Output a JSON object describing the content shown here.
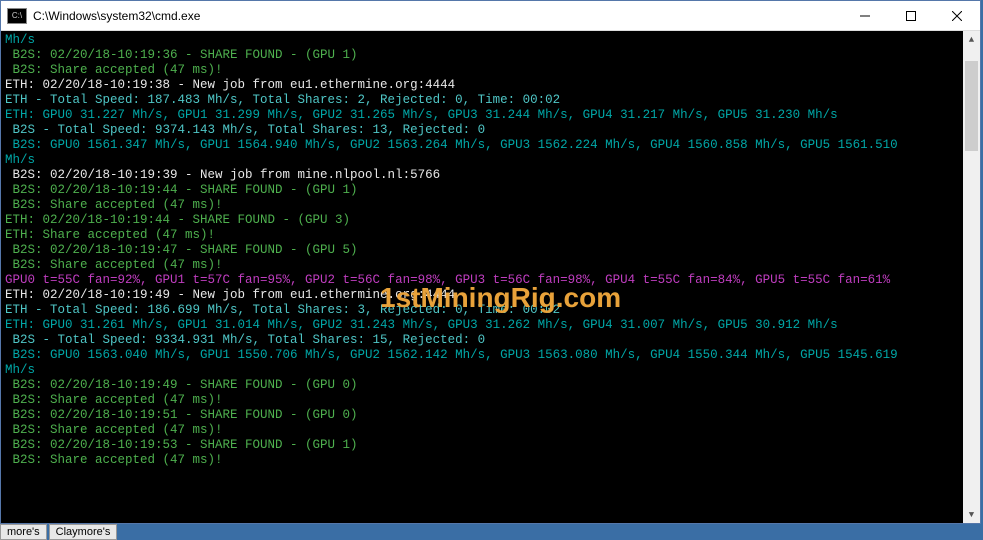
{
  "window": {
    "icon_label": "C:\\",
    "title": "C:\\Windows\\system32\\cmd.exe"
  },
  "watermark": "1stMiningRig.com",
  "taskbar": {
    "items": [
      "more's",
      "Claymore's"
    ]
  },
  "lines": [
    {
      "cls": "c-cyan",
      "text": "Mh/s"
    },
    {
      "cls": "c-green",
      "text": " B2S: 02/20/18-10:19:36 - SHARE FOUND - (GPU 1)"
    },
    {
      "cls": "c-green",
      "text": " B2S: Share accepted (47 ms)!"
    },
    {
      "cls": "c-white",
      "text": "ETH: 02/20/18-10:19:38 - New job from eu1.ethermine.org:4444"
    },
    {
      "cls": "c-lcyan",
      "text": "ETH - Total Speed: 187.483 Mh/s, Total Shares: 2, Rejected: 0, Time: 00:02"
    },
    {
      "cls": "c-cyan",
      "text": "ETH: GPU0 31.227 Mh/s, GPU1 31.299 Mh/s, GPU2 31.265 Mh/s, GPU3 31.244 Mh/s, GPU4 31.217 Mh/s, GPU5 31.230 Mh/s"
    },
    {
      "cls": "c-lcyan",
      "text": " B2S - Total Speed: 9374.143 Mh/s, Total Shares: 13, Rejected: 0"
    },
    {
      "cls": "c-cyan",
      "text": " B2S: GPU0 1561.347 Mh/s, GPU1 1564.940 Mh/s, GPU2 1563.264 Mh/s, GPU3 1562.224 Mh/s, GPU4 1560.858 Mh/s, GPU5 1561.510"
    },
    {
      "cls": "c-cyan",
      "text": "Mh/s"
    },
    {
      "cls": "c-white",
      "text": " B2S: 02/20/18-10:19:39 - New job from mine.nlpool.nl:5766"
    },
    {
      "cls": "c-green",
      "text": " B2S: 02/20/18-10:19:44 - SHARE FOUND - (GPU 1)"
    },
    {
      "cls": "c-green",
      "text": " B2S: Share accepted (47 ms)!"
    },
    {
      "cls": "c-green",
      "text": "ETH: 02/20/18-10:19:44 - SHARE FOUND - (GPU 3)"
    },
    {
      "cls": "c-green",
      "text": "ETH: Share accepted (47 ms)!"
    },
    {
      "cls": "c-green",
      "text": " B2S: 02/20/18-10:19:47 - SHARE FOUND - (GPU 5)"
    },
    {
      "cls": "c-green",
      "text": " B2S: Share accepted (47 ms)!"
    },
    {
      "cls": "c-mag",
      "text": "GPU0 t=55C fan=92%, GPU1 t=57C fan=95%, GPU2 t=56C fan=98%, GPU3 t=56C fan=98%, GPU4 t=55C fan=84%, GPU5 t=55C fan=61%"
    },
    {
      "cls": "c-white",
      "text": "ETH: 02/20/18-10:19:49 - New job from eu1.ethermine.org:4444"
    },
    {
      "cls": "c-lcyan",
      "text": "ETH - Total Speed: 186.699 Mh/s, Total Shares: 3, Rejected: 0, Time: 00:02"
    },
    {
      "cls": "c-cyan",
      "text": "ETH: GPU0 31.261 Mh/s, GPU1 31.014 Mh/s, GPU2 31.243 Mh/s, GPU3 31.262 Mh/s, GPU4 31.007 Mh/s, GPU5 30.912 Mh/s"
    },
    {
      "cls": "c-lcyan",
      "text": " B2S - Total Speed: 9334.931 Mh/s, Total Shares: 15, Rejected: 0"
    },
    {
      "cls": "c-cyan",
      "text": " B2S: GPU0 1563.040 Mh/s, GPU1 1550.706 Mh/s, GPU2 1562.142 Mh/s, GPU3 1563.080 Mh/s, GPU4 1550.344 Mh/s, GPU5 1545.619"
    },
    {
      "cls": "c-cyan",
      "text": "Mh/s"
    },
    {
      "cls": "c-green",
      "text": " B2S: 02/20/18-10:19:49 - SHARE FOUND - (GPU 0)"
    },
    {
      "cls": "c-green",
      "text": " B2S: Share accepted (47 ms)!"
    },
    {
      "cls": "c-green",
      "text": " B2S: 02/20/18-10:19:51 - SHARE FOUND - (GPU 0)"
    },
    {
      "cls": "c-green",
      "text": " B2S: Share accepted (47 ms)!"
    },
    {
      "cls": "c-green",
      "text": " B2S: 02/20/18-10:19:53 - SHARE FOUND - (GPU 1)"
    },
    {
      "cls": "c-green",
      "text": " B2S: Share accepted (47 ms)!"
    }
  ]
}
